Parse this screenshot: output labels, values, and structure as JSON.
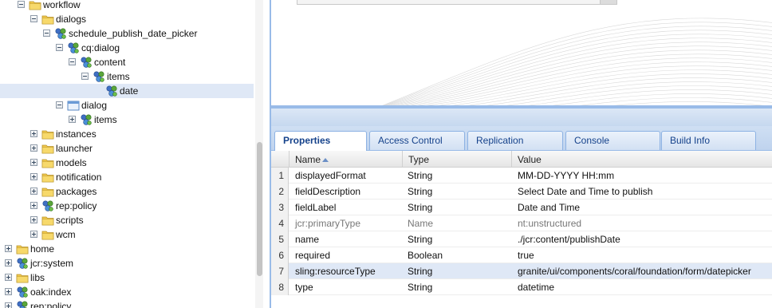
{
  "tree": {
    "items": [
      {
        "label": "workflow",
        "icon": "folder-icon",
        "toggle": "minus"
      },
      {
        "label": "dialogs",
        "icon": "folder-icon",
        "toggle": "minus"
      },
      {
        "label": "schedule_publish_date_picker",
        "icon": "component-node-icon",
        "toggle": "minus"
      },
      {
        "label": "cq:dialog",
        "icon": "component-node-icon",
        "toggle": "minus"
      },
      {
        "label": "content",
        "icon": "component-node-icon",
        "toggle": "minus"
      },
      {
        "label": "items",
        "icon": "component-node-icon",
        "toggle": "minus"
      },
      {
        "label": "date",
        "icon": "component-node-icon",
        "toggle": "none",
        "selected": true
      },
      {
        "label": "dialog",
        "icon": "dialog-node-icon",
        "toggle": "minus"
      },
      {
        "label": "items",
        "icon": "component-node-icon",
        "toggle": "plus"
      },
      {
        "label": "instances",
        "icon": "folder-icon",
        "toggle": "plus"
      },
      {
        "label": "launcher",
        "icon": "folder-icon",
        "toggle": "plus"
      },
      {
        "label": "models",
        "icon": "folder-icon",
        "toggle": "plus"
      },
      {
        "label": "notification",
        "icon": "folder-icon",
        "toggle": "plus"
      },
      {
        "label": "packages",
        "icon": "folder-icon",
        "toggle": "plus"
      },
      {
        "label": "rep:policy",
        "icon": "component-node-icon",
        "toggle": "plus"
      },
      {
        "label": "scripts",
        "icon": "folder-icon",
        "toggle": "plus"
      },
      {
        "label": "wcm",
        "icon": "folder-icon",
        "toggle": "plus"
      },
      {
        "label": "home",
        "icon": "folder-icon",
        "toggle": "plus"
      },
      {
        "label": "jcr:system",
        "icon": "component-node-icon",
        "toggle": "plus"
      },
      {
        "label": "libs",
        "icon": "folder-icon",
        "toggle": "plus"
      },
      {
        "label": "oak:index",
        "icon": "component-node-icon",
        "toggle": "plus"
      },
      {
        "label": "rep:policy",
        "icon": "component-node-icon",
        "toggle": "plus"
      }
    ]
  },
  "tabs": [
    {
      "label": "Properties",
      "active": true
    },
    {
      "label": "Access Control",
      "active": false
    },
    {
      "label": "Replication",
      "active": false
    },
    {
      "label": "Console",
      "active": false
    },
    {
      "label": "Build Info",
      "active": false
    }
  ],
  "grid": {
    "columns": {
      "name": "Name",
      "type": "Type",
      "value": "Value"
    },
    "sort_icon": "sort-ascending-icon",
    "rows": [
      {
        "num": "1",
        "name": "displayedFormat",
        "type": "String",
        "value": "MM-DD-YYYY HH:mm"
      },
      {
        "num": "2",
        "name": "fieldDescription",
        "type": "String",
        "value": "Select Date and Time to publish"
      },
      {
        "num": "3",
        "name": "fieldLabel",
        "type": "String",
        "value": "Date and Time"
      },
      {
        "num": "4",
        "name": "jcr:primaryType",
        "type": "Name",
        "value": "nt:unstructured",
        "muted": true
      },
      {
        "num": "5",
        "name": "name",
        "type": "String",
        "value": "./jcr:content/publishDate"
      },
      {
        "num": "6",
        "name": "required",
        "type": "Boolean",
        "value": "true"
      },
      {
        "num": "7",
        "name": "sling:resourceType",
        "type": "String",
        "value": "granite/ui/components/coral/foundation/form/datepicker",
        "selected": true
      },
      {
        "num": "8",
        "name": "type",
        "type": "String",
        "value": "datetime"
      }
    ]
  },
  "colors": {
    "folder": "#f2c94c",
    "node_blue": "#3f6fc4",
    "node_green": "#5aa63a",
    "selection": "#dfe8f6",
    "panel_border": "#99bbe8"
  }
}
